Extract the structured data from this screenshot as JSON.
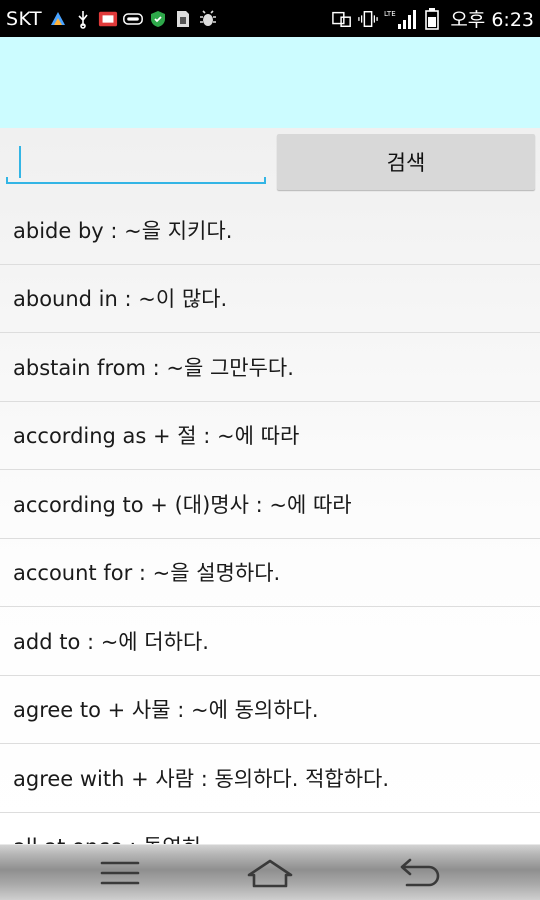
{
  "status_bar": {
    "carrier": "SKT",
    "lte": "LTE",
    "clock": "오후 6:23"
  },
  "search": {
    "input_value": "",
    "button_label": "검색"
  },
  "words": [
    "abide by : ~을 지키다.",
    "abound in : ~이 많다.",
    "abstain from : ~을 그만두다.",
    "according as  + 절 : ~에 따라",
    "according to  + (대)명사 : ~에 따라",
    "account for : ~을 설명하다.",
    "add to : ~에 더하다.",
    "agree to  + 사물 : ~에 동의하다.",
    "agree with  + 사람 : 동의하다. 적합하다.",
    "all at once : 돌연히"
  ],
  "colors": {
    "header_band": "#ccfcff",
    "accent": "#33b5e5"
  },
  "icons": {
    "nav": [
      "menu-icon",
      "home-icon",
      "back-icon"
    ]
  }
}
